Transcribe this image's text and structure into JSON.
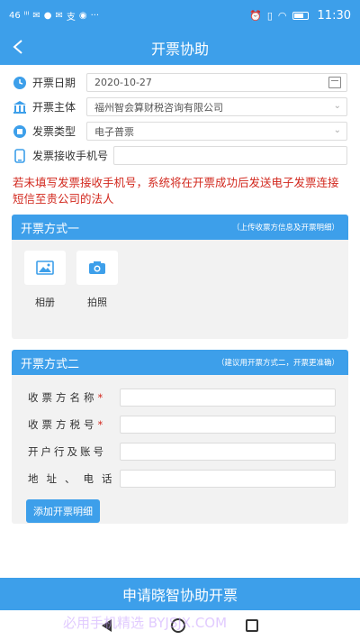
{
  "status_bar": {
    "left_items": [
      "46",
      "⁶",
      "ᴵᴵᴵ",
      "✉",
      "●",
      "✉",
      "支",
      "◉",
      "···"
    ],
    "time": "11:30"
  },
  "navbar": {
    "title": "开票协助"
  },
  "form": {
    "date_label": "开票日期",
    "date_value": "2020-10-27",
    "entity_label": "开票主体",
    "entity_value": "福州智会算财税咨询有限公司",
    "type_label": "发票类型",
    "type_value": "电子普票",
    "phone_label": "发票接收手机号",
    "phone_value": ""
  },
  "warning": "若未填写发票接收手机号，系统将在开票成功后发送电子发票连接短信至贵公司的法人",
  "method_one": {
    "title": "开票方式一",
    "note": "（上传收票方信息及开票明细）",
    "album_label": "相册",
    "camera_label": "拍照"
  },
  "method_two": {
    "title": "开票方式二",
    "note": "（建议用开票方式二，开票更准确）",
    "fields": [
      {
        "label": "收票方名称",
        "required_mark": "*"
      },
      {
        "label": "收票方税号",
        "required_mark": "*"
      },
      {
        "label": "开户行及账号",
        "required_mark": ""
      },
      {
        "label": "地址、电话",
        "required_mark": ""
      }
    ],
    "add_button": "添加开票明细"
  },
  "submit_button": "申请晓智协助开票",
  "watermark": "必用手机精选 BYJSJX.COM",
  "colors": {
    "accent": "#3d9fea",
    "warning": "#d2281e"
  }
}
